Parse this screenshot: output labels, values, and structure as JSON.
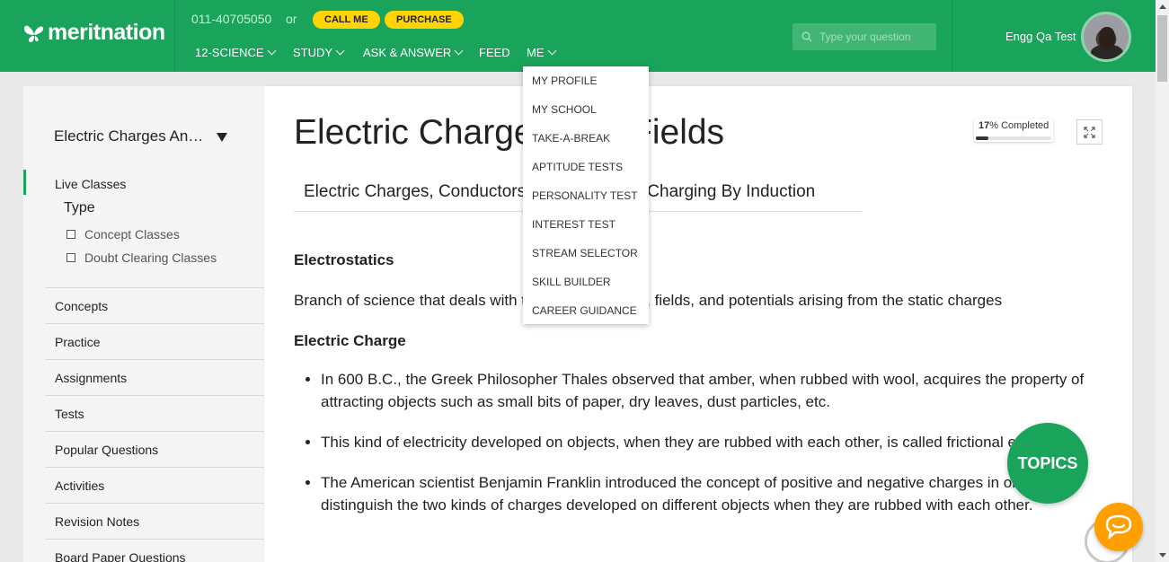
{
  "header": {
    "logo_text": "meritnation",
    "phone": "011-40705050",
    "or_text": "or",
    "call_label": "CALL ME",
    "purchase_label": "PURCHASE",
    "search_placeholder": "Type your question",
    "user_name": "Engg Qa Test",
    "nav": [
      {
        "label": "12-SCIENCE"
      },
      {
        "label": "STUDY"
      },
      {
        "label": "ASK & ANSWER"
      },
      {
        "label": "FEED"
      },
      {
        "label": "ME"
      }
    ]
  },
  "me_menu": [
    "MY PROFILE",
    "MY SCHOOL",
    "TAKE-A-BREAK",
    "APTITUDE TESTS",
    "PERSONALITY TEST",
    "INTEREST TEST",
    "STREAM SELECTOR",
    "SKILL BUILDER",
    "CAREER GUIDANCE"
  ],
  "sidebar": {
    "chapter": "Electric Charges And Fields",
    "live_classes": "Live Classes",
    "type_label": "Type",
    "filters": [
      "Concept Classes",
      "Doubt Clearing Classes"
    ],
    "items": [
      "Concepts",
      "Practice",
      "Assignments",
      "Tests",
      "Popular Questions",
      "Activities",
      "Revision Notes",
      "Board Paper Questions"
    ]
  },
  "content": {
    "title": "Electric Charges And Fields",
    "subtopic": "Electric Charges, Conductors and Insulators, Charging By Induction",
    "progress_value": "17",
    "progress_suffix": "% Completed",
    "progress_fraction": 0.17,
    "h_electrostatics": "Electrostatics",
    "p_electrostatics": "Branch of science that deals with the study of forces, fields, and potentials arising from the static charges",
    "h_charge": "Electric Charge",
    "bullets": [
      "In 600 B.C., the Greek Philosopher Thales observed that amber, when rubbed with wool, acquires the property of attracting objects such as small bits of paper, dry leaves, dust particles, etc.",
      "This kind of electricity developed on objects, when they are rubbed with each other, is called frictional electricity.",
      "The American scientist Benjamin Franklin introduced the concept of positive and negative charges in order to distinguish the two kinds of charges developed on different objects when they are rubbed with each other."
    ]
  },
  "topics_label": "TOPICS",
  "colors": {
    "brand": "#1aa35a",
    "accent": "#ffd400",
    "chat": "#ff9f00"
  }
}
